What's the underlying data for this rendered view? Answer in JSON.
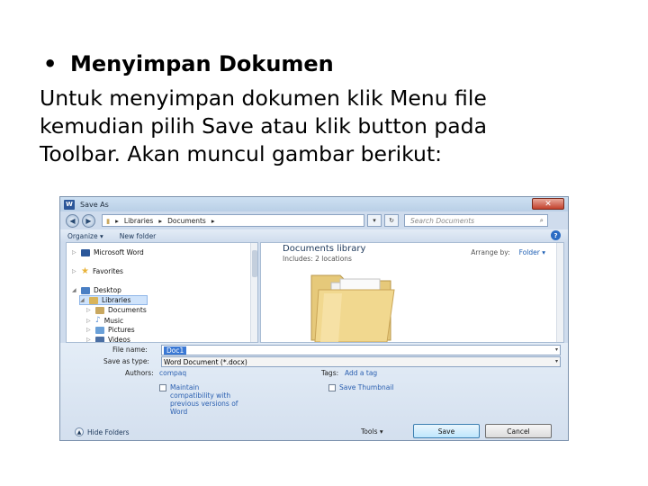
{
  "slide": {
    "bullet": "•",
    "heading": "Menyimpan Dokumen",
    "paragraph_lines": [
      "Untuk menyimpan dokumen klik Menu file",
      "kemudian pilih Save atau klik button pada",
      "Toolbar. Akan muncul gambar berikut:"
    ]
  },
  "dialog": {
    "title": "Save As",
    "close_label": "✕",
    "address": [
      "Libraries",
      "Documents"
    ],
    "search_placeholder": "Search Documents",
    "toolbar": {
      "organize": "Organize ▾",
      "new_folder": "New folder"
    },
    "tree": [
      {
        "label": "Microsoft Word",
        "color": "#2b579a"
      },
      {
        "label": "Favorites",
        "color": "#e8b33a"
      },
      {
        "label": "Desktop",
        "color": "#4a7fc4"
      },
      {
        "label": "Libraries",
        "color": "#d9b45a"
      },
      {
        "label": "Documents",
        "color": "#c9a860"
      },
      {
        "label": "Music",
        "color": "#5b8ed4"
      },
      {
        "label": "Pictures",
        "color": "#6aa0d8"
      },
      {
        "label": "Videos",
        "color": "#4b6fa4"
      }
    ],
    "library": {
      "title": "Documents library",
      "subtitle": "Includes: 2 locations",
      "arrange_label": "Arrange by:",
      "arrange_value": "Folder ▾"
    },
    "fields": {
      "file_name_label": "File name:",
      "file_name_value": "Doc1",
      "save_type_label": "Save as type:",
      "save_type_value": "Word Document (*.docx)",
      "authors_label": "Authors:",
      "authors_value": "compaq",
      "tags_label": "Tags:",
      "tags_value": "Add a tag",
      "maintain_lines": [
        "Maintain",
        "compatibility with",
        "previous versions of",
        "Word"
      ],
      "thumbnail_label": "Save Thumbnail"
    },
    "footer": {
      "hide_folders": "Hide Folders",
      "tools": "Tools ▾",
      "save": "Save",
      "cancel": "Cancel"
    }
  }
}
